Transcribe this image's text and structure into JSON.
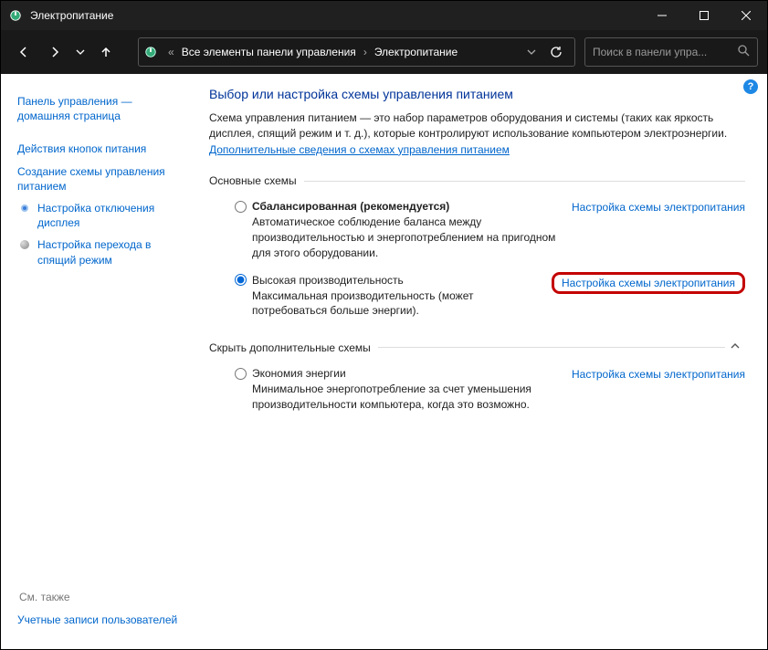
{
  "titlebar": {
    "title": "Электропитание"
  },
  "breadcrumb": {
    "prefix": "«",
    "seg1": "Все элементы панели управления",
    "seg2": "Электропитание"
  },
  "search": {
    "placeholder": "Поиск в панели упра..."
  },
  "sidebar": {
    "home": "Панель управления — домашняя страница",
    "items": [
      {
        "label": "Действия кнопок питания"
      },
      {
        "label": "Создание схемы управления питанием"
      },
      {
        "label": "Настройка отключения дисплея"
      },
      {
        "label": "Настройка перехода в спящий режим"
      }
    ],
    "see_also_label": "См. также",
    "see_also_link": "Учетные записи пользователей"
  },
  "main": {
    "heading": "Выбор или настройка схемы управления питанием",
    "description": "Схема управления питанием — это набор параметров оборудования и системы (таких как яркость дисплея, спящий режим и т. д.), которые контролируют использование компьютером электроэнергии. ",
    "more_link": "Дополнительные сведения о схемах управления питанием",
    "section_basic": "Основные схемы",
    "section_hide": "Скрыть дополнительные схемы",
    "config_link": "Настройка схемы электропитания",
    "plans": {
      "balanced": {
        "name": "Сбалансированная (рекомендуется)",
        "desc": "Автоматическое соблюдение баланса между производительностью и энергопотреблением на пригодном для этого оборудовании."
      },
      "high": {
        "name": "Высокая производительность",
        "desc": "Максимальная производительность (может потребоваться больше энергии)."
      },
      "eco": {
        "name": "Экономия энергии",
        "desc": "Минимальное энергопотребление за счет уменьшения производительности компьютера, когда это возможно."
      }
    }
  }
}
